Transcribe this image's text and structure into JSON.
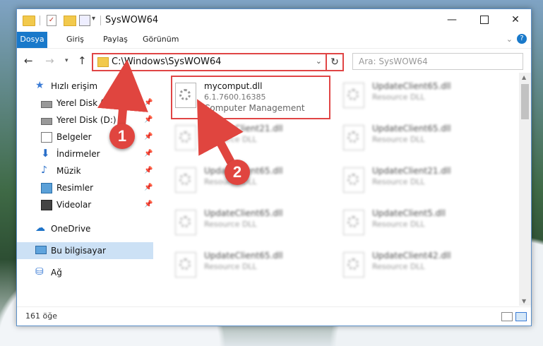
{
  "window": {
    "title": "SysWOW64"
  },
  "ribbon": {
    "tabs": [
      "Dosya",
      "Giriş",
      "Paylaş",
      "Görünüm"
    ]
  },
  "nav": {
    "address": "C:\\Windows\\SysWOW64",
    "search_placeholder": "Ara: SysWOW64"
  },
  "sidebar": {
    "quick_access": "Hızlı erişim",
    "items": [
      {
        "label": "Yerel Disk (C:)",
        "icon": "drive-icon"
      },
      {
        "label": "Yerel Disk (D:)",
        "icon": "drive-icon"
      },
      {
        "label": "Belgeler",
        "icon": "documents-icon"
      },
      {
        "label": "İndirmeler",
        "icon": "downloads-icon"
      },
      {
        "label": "Müzik",
        "icon": "music-icon"
      },
      {
        "label": "Resimler",
        "icon": "pictures-icon"
      },
      {
        "label": "Videolar",
        "icon": "videos-icon"
      }
    ],
    "onedrive": "OneDrive",
    "this_pc": "Bu bilgisayar",
    "network": "Ağ"
  },
  "files": [
    {
      "name": "mycomput.dll",
      "sub1": "6.1.7600.16385",
      "sub2": "Computer Management"
    },
    {
      "name": "UpdateClient65.dll",
      "sub1": "Resource DLL"
    },
    {
      "name": "UpdateClient21.dll",
      "sub1": "Resource DLL"
    },
    {
      "name": "UpdateClient65.dll",
      "sub1": "Resource DLL"
    },
    {
      "name": "UpdateClient65.dll",
      "sub1": "Resource DLL"
    },
    {
      "name": "UpdateClient21.dll",
      "sub1": "Resource DLL"
    },
    {
      "name": "UpdateClient65.dll",
      "sub1": "Resource DLL"
    },
    {
      "name": "UpdateClient5.dll",
      "sub1": "Resource DLL"
    },
    {
      "name": "UpdateClient65.dll",
      "sub1": "Resource DLL"
    },
    {
      "name": "UpdateClient42.dll",
      "sub1": "Resource DLL"
    }
  ],
  "status": {
    "count": "161 öğe"
  },
  "annotations": {
    "marker1": "1",
    "marker2": "2",
    "color": "#e0453f"
  }
}
